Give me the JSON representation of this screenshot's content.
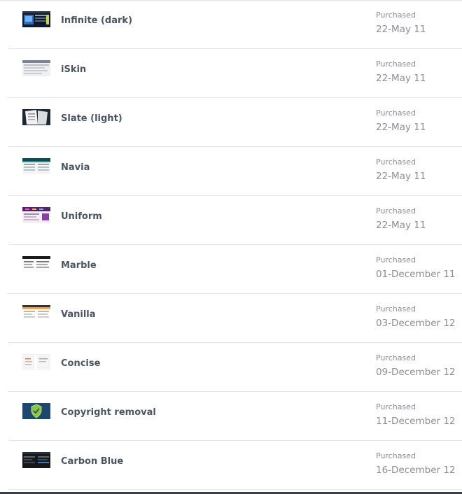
{
  "purchases": [
    {
      "name": "Infinite (dark)",
      "status": "Purchased",
      "date": "22-May 11",
      "thumb_icon": "dark-skin-thumbnail"
    },
    {
      "name": "iSkin",
      "status": "Purchased",
      "date": "22-May 11",
      "thumb_icon": "light-grey-skin-thumbnail"
    },
    {
      "name": "Slate (light)",
      "status": "Purchased",
      "date": "22-May 11",
      "thumb_icon": "slate-skin-thumbnail"
    },
    {
      "name": "Navia",
      "status": "Purchased",
      "date": "22-May 11",
      "thumb_icon": "teal-skin-thumbnail"
    },
    {
      "name": "Uniform",
      "status": "Purchased",
      "date": "22-May 11",
      "thumb_icon": "purple-skin-thumbnail"
    },
    {
      "name": "Marble",
      "status": "Purchased",
      "date": "01-December 11",
      "thumb_icon": "black-white-skin-thumbnail"
    },
    {
      "name": "Vanilla",
      "status": "Purchased",
      "date": "03-December 12",
      "thumb_icon": "orange-skin-thumbnail"
    },
    {
      "name": "Concise",
      "status": "Purchased",
      "date": "09-December 12",
      "thumb_icon": "white-skin-thumbnail"
    },
    {
      "name": "Copyright removal",
      "status": "Purchased",
      "date": "11-December 12",
      "thumb_icon": "shield-check-icon"
    },
    {
      "name": "Carbon Blue",
      "status": "Purchased",
      "date": "16-December 12",
      "thumb_icon": "carbon-skin-thumbnail"
    }
  ],
  "colors": {
    "name_text": "#4b5565",
    "meta_text": "#8a8f96",
    "divider": "#e6e6e6"
  }
}
